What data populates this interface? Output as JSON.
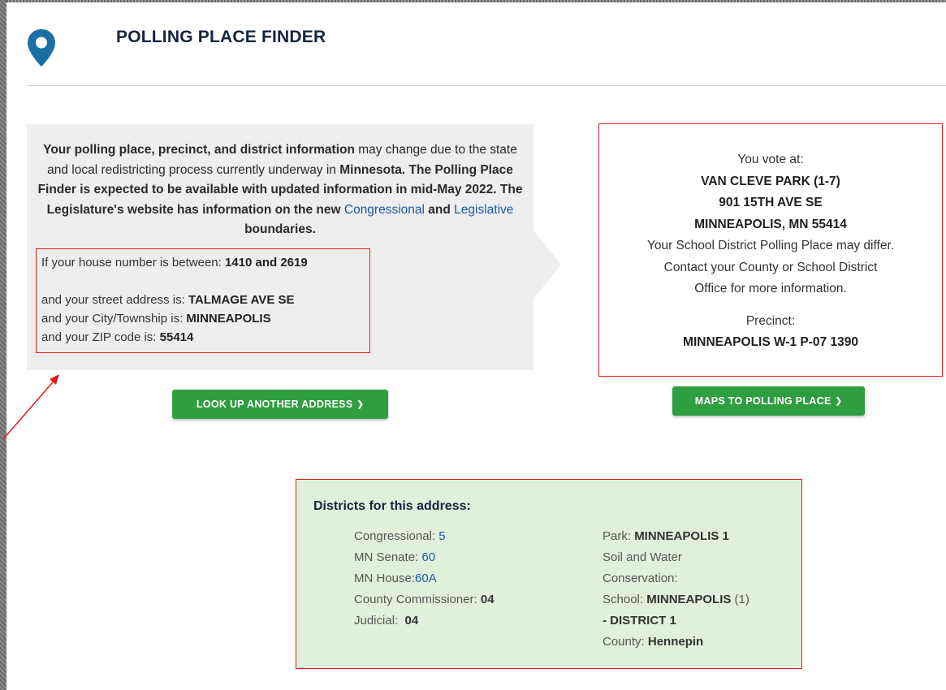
{
  "header": {
    "title": "POLLING PLACE FINDER",
    "icon": "map-pin-icon",
    "icon_color": "#1a6fa3"
  },
  "notice": {
    "text_1": "Your polling place, precinct, and district information",
    "text_2": " may change due to the state and local redistricting process currently underway in ",
    "text_3": "Minnesota. The Polling Place Finder is expected to be available with updated information in mid-May 2022. The Legislature's website has information on the new ",
    "link_congressional": "Congressional",
    "and": " and ",
    "link_legislative": "Legislative",
    "text_4": " boundaries."
  },
  "address": {
    "house_label": "If your house number is between: ",
    "house_range": "1410 and 2619",
    "street_label": "and your street address is: ",
    "street": "TALMAGE AVE SE",
    "city_label": "and your City/Township is: ",
    "city": "MINNEAPOLIS",
    "zip_label": "and your ZIP code is: ",
    "zip": "55414"
  },
  "vote": {
    "intro": "You vote at:",
    "place": "VAN CLEVE PARK (1-7)",
    "street": "901 15TH AVE SE",
    "city": "MINNEAPOLIS, MN 55414",
    "note_1": "Your School District Polling Place may differ.",
    "note_2": "Contact your County or School District",
    "note_3": "Office for more information.",
    "precinct_label": "Precinct:",
    "precinct": "MINNEAPOLIS W-1 P-07 1390"
  },
  "buttons": {
    "lookup": "LOOK UP ANOTHER ADDRESS",
    "maps": "MAPS TO POLLING PLACE",
    "chevron": "❯",
    "color": "#2e9e3e"
  },
  "districts": {
    "title": "Districts for this address:",
    "congressional_label": "Congressional: ",
    "congressional": "5",
    "senate_label": "MN Senate: ",
    "senate": "60",
    "house_label": "MN House:",
    "house": "60A",
    "county_comm_label": "County Commissioner: ",
    "county_comm": "04",
    "judicial_label": "Judicial:  ",
    "judicial": "04",
    "park_label": "Park: ",
    "park": "MINNEAPOLIS 1",
    "soil_1": "Soil and Water",
    "soil_2": "Conservation:",
    "school_label": "School: ",
    "school": "MINNEAPOLIS",
    "school_num": " (1)",
    "school_district": "- DISTRICT 1",
    "county_label": "County: ",
    "county": "Hennepin"
  },
  "colors": {
    "highlight_border": "#e01b1b",
    "district_bg": "#e1f0dc",
    "link": "#1a5aa0"
  }
}
